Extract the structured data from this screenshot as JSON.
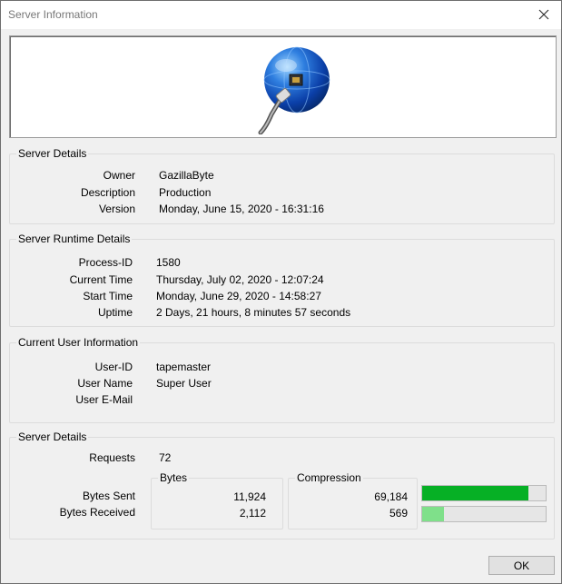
{
  "window": {
    "title": "Server Information"
  },
  "server_details": {
    "title": "Server Details",
    "rows": [
      {
        "label": "Owner",
        "value": "GazillaByte"
      },
      {
        "label": "Description",
        "value": "Production"
      },
      {
        "label": "Version",
        "value": "Monday, June 15, 2020 - 16:31:16"
      }
    ]
  },
  "runtime": {
    "title": "Server Runtime Details",
    "rows": [
      {
        "label": "Process-ID",
        "value": "1580"
      },
      {
        "label": "Current Time",
        "value": "Thursday, July 02, 2020 - 12:07:24"
      },
      {
        "label": "Start Time",
        "value": "Monday, June 29, 2020 - 14:58:27"
      },
      {
        "label": "Uptime",
        "value": "2 Days, 21 hours, 8 minutes 57 seconds"
      }
    ]
  },
  "user": {
    "title": "Current User Information",
    "rows": [
      {
        "label": "User-ID",
        "value": "tapemaster"
      },
      {
        "label": "User Name",
        "value": "Super User"
      },
      {
        "label": "User E-Mail",
        "value": ""
      }
    ]
  },
  "traffic": {
    "title": "Server Details",
    "requests_label": "Requests",
    "requests_value": "72",
    "bytes_title": "Bytes",
    "compression_title": "Compression",
    "bytes_sent_label": "Bytes Sent",
    "bytes_received_label": "Bytes Received",
    "bytes_sent": "11,924",
    "bytes_received": "2,112",
    "compression_sent": "69,184",
    "compression_received": "569",
    "sent_ratio": 0.86,
    "received_ratio": 0.18
  },
  "colors": {
    "bar_sent": "#06b025",
    "bar_received": "#7fe08a"
  },
  "buttons": {
    "ok": "OK"
  }
}
